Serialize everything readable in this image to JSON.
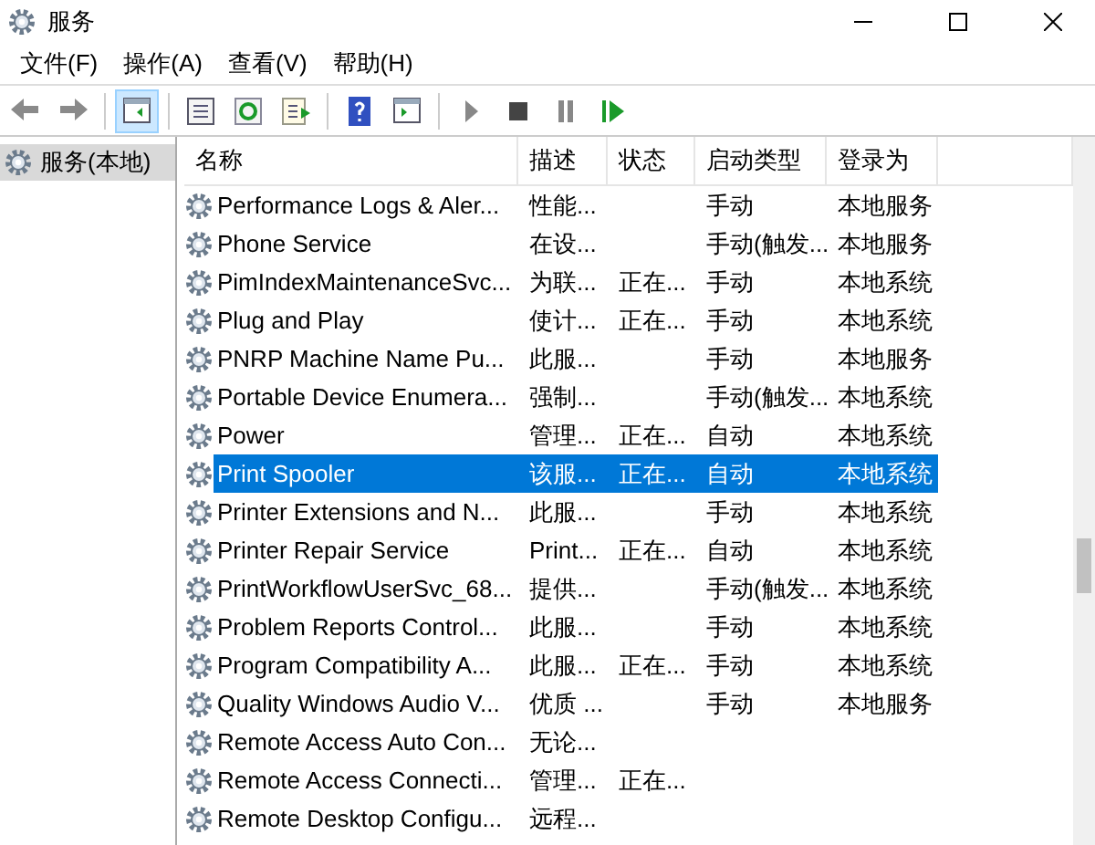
{
  "window": {
    "title": "服务"
  },
  "menu": [
    "文件(F)",
    "操作(A)",
    "查看(V)",
    "帮助(H)"
  ],
  "toolbar": [
    {
      "kind": "back",
      "selected": false
    },
    {
      "kind": "forward",
      "selected": false
    },
    {
      "kind": "tree",
      "selected": true
    },
    {
      "kind": "properties",
      "selected": false
    },
    {
      "kind": "refresh",
      "selected": false
    },
    {
      "kind": "export",
      "selected": false
    },
    {
      "kind": "help",
      "selected": false
    },
    {
      "kind": "pane",
      "selected": false
    },
    {
      "kind": "start",
      "selected": false
    },
    {
      "kind": "stop",
      "selected": false
    },
    {
      "kind": "pause",
      "selected": false
    },
    {
      "kind": "resume",
      "selected": false
    }
  ],
  "sidebar": {
    "items": [
      {
        "label": "服务(本地)",
        "selected": true
      }
    ]
  },
  "table": {
    "columns": [
      "名称",
      "描述",
      "状态",
      "启动类型",
      "登录为"
    ],
    "rows": [
      {
        "cells": [
          "Performance Logs & Aler...",
          "性能...",
          "",
          "手动",
          "本地服务"
        ],
        "selected": false
      },
      {
        "cells": [
          "Phone Service",
          "在设...",
          "",
          "手动(触发...",
          "本地服务"
        ],
        "selected": false
      },
      {
        "cells": [
          "PimIndexMaintenanceSvc...",
          "为联...",
          "正在...",
          "手动",
          "本地系统"
        ],
        "selected": false
      },
      {
        "cells": [
          "Plug and Play",
          "使计...",
          "正在...",
          "手动",
          "本地系统"
        ],
        "selected": false
      },
      {
        "cells": [
          "PNRP Machine Name Pu...",
          "此服...",
          "",
          "手动",
          "本地服务"
        ],
        "selected": false
      },
      {
        "cells": [
          "Portable Device Enumera...",
          "强制...",
          "",
          "手动(触发...",
          "本地系统"
        ],
        "selected": false
      },
      {
        "cells": [
          "Power",
          "管理...",
          "正在...",
          "自动",
          "本地系统"
        ],
        "selected": false
      },
      {
        "cells": [
          "Print Spooler",
          "该服...",
          "正在...",
          "自动",
          "本地系统"
        ],
        "selected": true
      },
      {
        "cells": [
          "Printer Extensions and N...",
          "此服...",
          "",
          "手动",
          "本地系统"
        ],
        "selected": false
      },
      {
        "cells": [
          "Printer Repair Service",
          "Print...",
          "正在...",
          "自动",
          "本地系统"
        ],
        "selected": false
      },
      {
        "cells": [
          "PrintWorkflowUserSvc_68...",
          "提供...",
          "",
          "手动(触发...",
          "本地系统"
        ],
        "selected": false
      },
      {
        "cells": [
          "Problem Reports Control...",
          "此服...",
          "",
          "手动",
          "本地系统"
        ],
        "selected": false
      },
      {
        "cells": [
          "Program Compatibility A...",
          "此服...",
          "正在...",
          "手动",
          "本地系统"
        ],
        "selected": false
      },
      {
        "cells": [
          "Quality Windows Audio V...",
          "优质 ...",
          "",
          "手动",
          "本地服务"
        ],
        "selected": false
      },
      {
        "cells": [
          "Remote Access Auto Con...",
          "无论...",
          "",
          "",
          ""
        ],
        "selected": false
      },
      {
        "cells": [
          "Remote Access Connecti...",
          "管理...",
          "正在...",
          "",
          ""
        ],
        "selected": false
      },
      {
        "cells": [
          "Remote Desktop Configu...",
          "远程...",
          "",
          "",
          ""
        ],
        "selected": false
      }
    ]
  }
}
